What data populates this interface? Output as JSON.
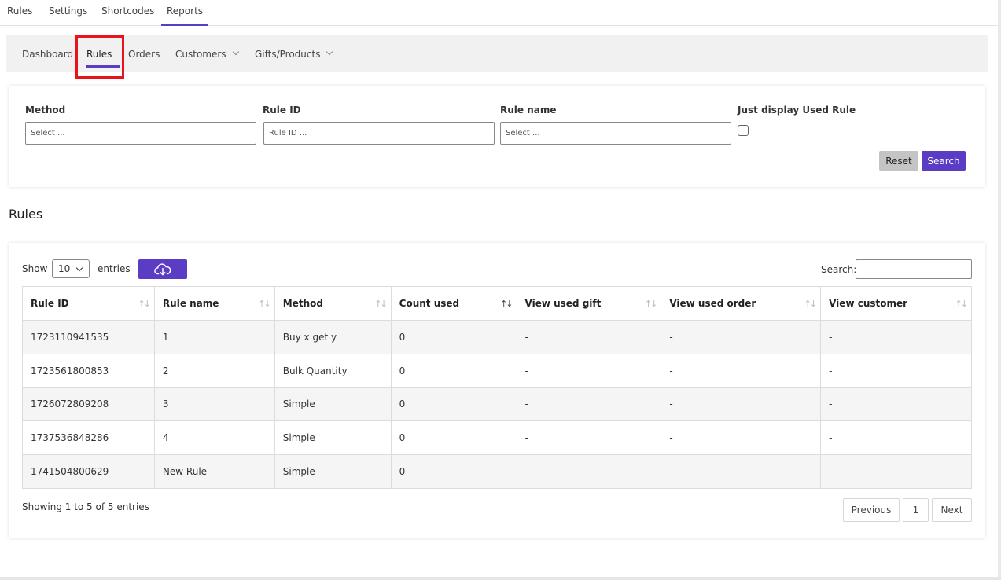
{
  "top_tabs": [
    "Rules",
    "Settings",
    "Shortcodes",
    "Reports"
  ],
  "subnav": {
    "dashboard": "Dashboard",
    "rules": "Rules",
    "orders": "Orders",
    "customers": "Customers",
    "gifts": "Gifts/Products"
  },
  "filters": {
    "method_label": "Method",
    "method_placeholder": "Select ...",
    "rule_id_label": "Rule ID",
    "rule_id_placeholder": "Rule ID ...",
    "rule_name_label": "Rule name",
    "rule_name_placeholder": "Select ...",
    "used_label": "Just display Used Rule",
    "reset": "Reset",
    "search": "Search"
  },
  "section_title": "Rules",
  "table_controls": {
    "show": "Show",
    "page_size": "10",
    "entries": "entries",
    "search_label": "Search:"
  },
  "columns": [
    "Rule ID",
    "Rule name",
    "Method",
    "Count used",
    "View used gift",
    "View used order",
    "View customer"
  ],
  "rows": [
    [
      "1723110941535",
      "1",
      "Buy x get y",
      "0",
      "-",
      "-",
      "-"
    ],
    [
      "1723561800853",
      "2",
      "Bulk Quantity",
      "0",
      "-",
      "-",
      "-"
    ],
    [
      "1726072809208",
      "3",
      "Simple",
      "0",
      "-",
      "-",
      "-"
    ],
    [
      "1737536848286",
      "4",
      "Simple",
      "0",
      "-",
      "-",
      "-"
    ],
    [
      "1741504800629",
      "New Rule",
      "Simple",
      "0",
      "-",
      "-",
      "-"
    ]
  ],
  "footer": {
    "info": "Showing 1 to 5 of 5 entries",
    "previous": "Previous",
    "page": "1",
    "next": "Next"
  },
  "colors": {
    "accent": "#5b3cc4",
    "highlight": "#e8141c"
  }
}
